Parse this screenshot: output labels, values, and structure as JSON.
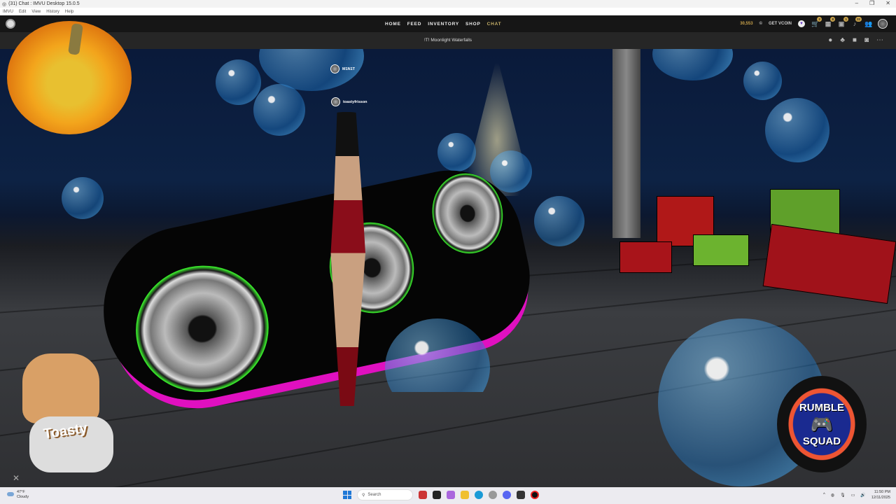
{
  "window": {
    "title": "(31) Chat : IMVU Desktop 15.0.5",
    "controls": [
      "–",
      "❐",
      "✕"
    ]
  },
  "menu": [
    "IMVU",
    "Edit",
    "View",
    "History",
    "Help"
  ],
  "nav": {
    "items": [
      {
        "label": "HOME"
      },
      {
        "label": "FEED"
      },
      {
        "label": "INVENTORY"
      },
      {
        "label": "SHOP"
      },
      {
        "label": "CHAT",
        "active": true
      }
    ]
  },
  "header": {
    "credits": "30,553",
    "get_vcoin": "GET VCOIN",
    "badges": {
      "cart": "2",
      "gifts": "8",
      "outfits": "1",
      "notifications": "22"
    }
  },
  "room": {
    "name": "!T! Moonlight Waterfalls"
  },
  "nametags": {
    "user1": "M1N1T",
    "user2": "toastyfrisson"
  },
  "overlay": {
    "toasty_label": "Toasty",
    "rumble_top": "RUMBLE",
    "rumble_bottom": "SQUAD"
  },
  "taskbar": {
    "temp": "47°F",
    "weather": "Cloudy",
    "search_placeholder": "Search",
    "time": "11:50 PM",
    "date": "12/11/2025"
  },
  "colors": {
    "accent": "#c9a24a",
    "chat_active": "#c9b36a",
    "speaker_green": "#39e62a",
    "speaker_pink": "#e010c0"
  }
}
